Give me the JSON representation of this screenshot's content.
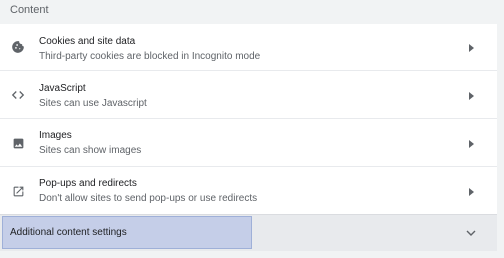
{
  "section": {
    "title": "Content"
  },
  "rows": [
    {
      "title": "Cookies and site data",
      "subtitle": "Third-party cookies are blocked in Incognito mode",
      "icon": "cookie-icon"
    },
    {
      "title": "JavaScript",
      "subtitle": "Sites can use Javascript",
      "icon": "code-icon"
    },
    {
      "title": "Images",
      "subtitle": "Sites can show images",
      "icon": "image-icon"
    },
    {
      "title": "Pop-ups and redirects",
      "subtitle": "Don't allow sites to send pop-ups or use redirects",
      "icon": "open-in-new-icon"
    }
  ],
  "additional": {
    "label": "Additional content settings",
    "icon": "chevron-down-icon"
  },
  "colors": {
    "highlight": "#c5cee8",
    "icon": "#5f6368",
    "background": "#f1f3f4"
  }
}
